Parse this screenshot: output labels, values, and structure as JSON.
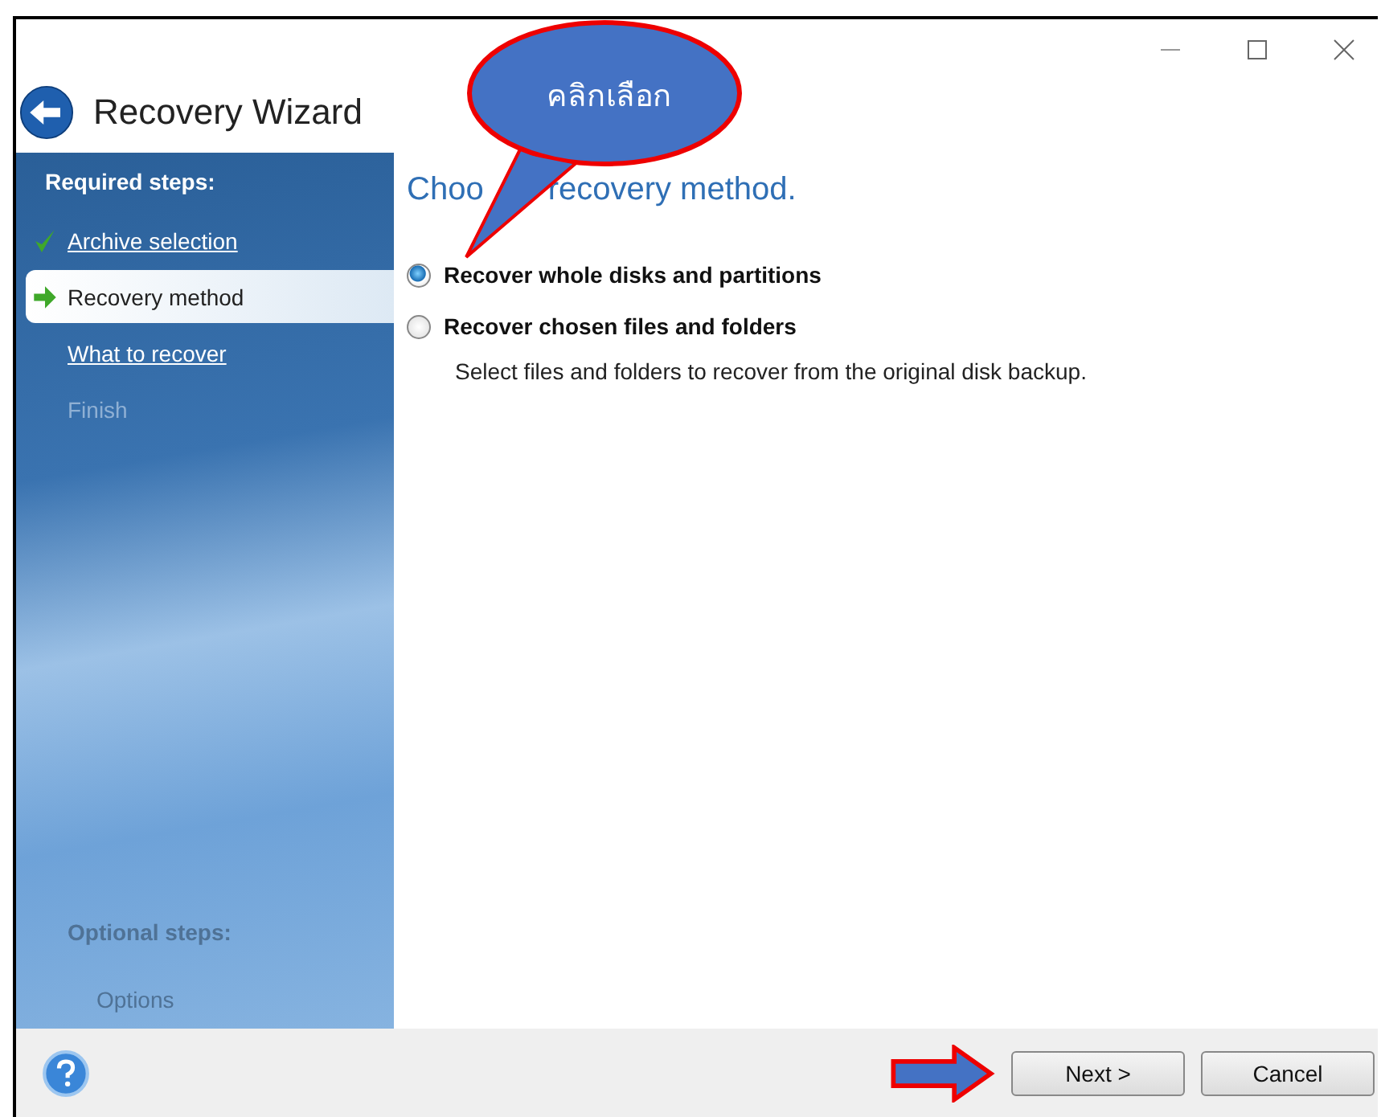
{
  "window": {
    "title": "Recovery Wizard"
  },
  "sidebar": {
    "required_heading": "Required steps:",
    "steps": [
      {
        "label": "Archive selection",
        "kind": "done",
        "selected": false
      },
      {
        "label": "Recovery method",
        "kind": "current",
        "selected": true
      },
      {
        "label": "What to recover",
        "kind": "link",
        "selected": false
      },
      {
        "label": "Finish",
        "kind": "disabled",
        "selected": false
      }
    ],
    "optional_heading": "Optional steps:",
    "optional_steps": [
      {
        "label": "Options",
        "kind": "disabled",
        "selected": false
      }
    ]
  },
  "content": {
    "heading_parts": [
      "Choo",
      "recovery method."
    ],
    "options": [
      {
        "label": "Recover whole disks and partitions",
        "selected": true
      },
      {
        "label": "Recover chosen files and folders",
        "selected": false
      }
    ],
    "description": "Select files and folders to recover from the original disk backup."
  },
  "callout": {
    "text": "คลิกเลือก"
  },
  "buttons": [
    {
      "label": "Next >",
      "kind": "next"
    },
    {
      "label": "Cancel",
      "kind": "cancel"
    }
  ]
}
